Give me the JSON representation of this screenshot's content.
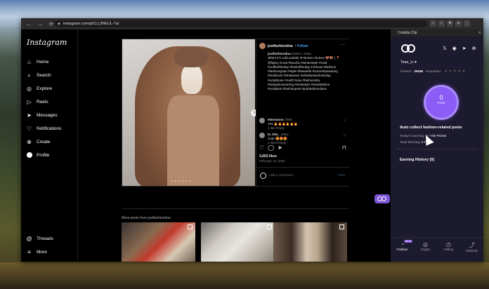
{
  "browser": {
    "url": "instagram.com/p/CLL3NEUL-7a/",
    "nav_back": "←",
    "nav_forward": "→",
    "nav_reload": "⟳"
  },
  "instagram": {
    "logo": "Instagram",
    "nav": [
      {
        "label": "Home",
        "icon": "⌂"
      },
      {
        "label": "Search",
        "icon": "⌕"
      },
      {
        "label": "Explore",
        "icon": "◎"
      },
      {
        "label": "Reels",
        "icon": "▷"
      },
      {
        "label": "Messages",
        "icon": "➤"
      },
      {
        "label": "Notifications",
        "icon": "♡"
      },
      {
        "label": "Create",
        "icon": "⊕"
      },
      {
        "label": "Profile",
        "icon": ""
      }
    ],
    "nav_bottom": [
      {
        "label": "Threads",
        "icon": "@"
      },
      {
        "label": "More",
        "icon": "≡"
      }
    ],
    "post": {
      "author": "justfashiondna",
      "follow": "• Follow",
      "caption_author": "justfashiondna",
      "caption_meta": "Edited • 209w",
      "caption": "When it’s cold outside ❄ Brown choices 🤎🤎 | 📍 @figmy #coat #fauxfur #winterstyle #ootd #outfitoftheday #lookoftheday #11fcars #fashion #fashiongram #style #beautiful #currentlywearing #lookbook #whatiwore #whatiwearwhotoday #ootdshare #outfit #wiw #fashionista #todaysimwearing #instastyle #instafashion #ootdpost #fashionpost #justfashiondana",
      "comments": [
        {
          "author": "eleonavoo",
          "meta": "209w",
          "text": "Yes 🔥🔥🔥🔥🔥🔥",
          "sub": "1 like   Reply"
        },
        {
          "author": "lu_bku_",
          "meta": "209w",
          "text": "Cute 😍😍😍",
          "sub": "2 likes   Reply"
        }
      ],
      "likes": "3,653 likes",
      "date": "February 12, 2021",
      "comment_placeholder": "Add a comment...",
      "comment_post": "Post",
      "more_posts": "More posts from justfashiondna",
      "carousel_dots": "• • • • • •"
    }
  },
  "panel": {
    "title": "Codatta Clip",
    "user": "Tess_Li ▾",
    "reward_label": "Reward",
    "reward_value": "25048",
    "reputation_label": "Reputation",
    "stars": "★★★★★",
    "points": "0",
    "points_label": "Posts",
    "auto_title": "Auto collect fashion-related posts",
    "todays_label": "Today’s Earning:",
    "todays_value": "0 / 750 Points",
    "total_label": "Total Earning:",
    "total_value": "0 Points",
    "history": "Earning History (0)",
    "tabs": [
      {
        "label": "Fashion",
        "icon": "◔",
        "badge": "NEW"
      },
      {
        "label": "Crypto",
        "icon": "◎"
      },
      {
        "label": "History",
        "icon": "◷"
      },
      {
        "label": "Referral",
        "icon": "⤴"
      }
    ],
    "social_icons": [
      "𝕏",
      "◉",
      "➤",
      "⊕"
    ]
  }
}
